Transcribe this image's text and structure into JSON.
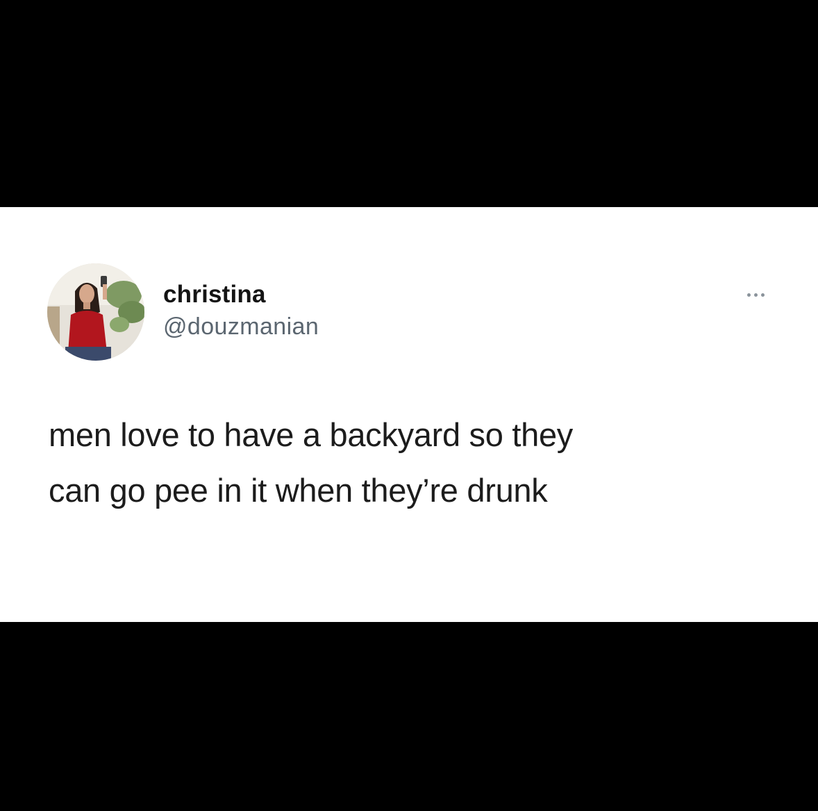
{
  "tweet": {
    "author": {
      "display_name": "christina",
      "handle": "@douzmanian",
      "avatar_icon": "profile-photo"
    },
    "more_icon": "ellipsis-icon",
    "text_lines": [
      "men love to have a backyard so they",
      "can go pee in it when they’re drunk"
    ]
  },
  "colors": {
    "frame": "#000000",
    "card": "#ffffff",
    "name": "#141414",
    "handle": "#5b6670",
    "text": "#1c1c1c"
  }
}
